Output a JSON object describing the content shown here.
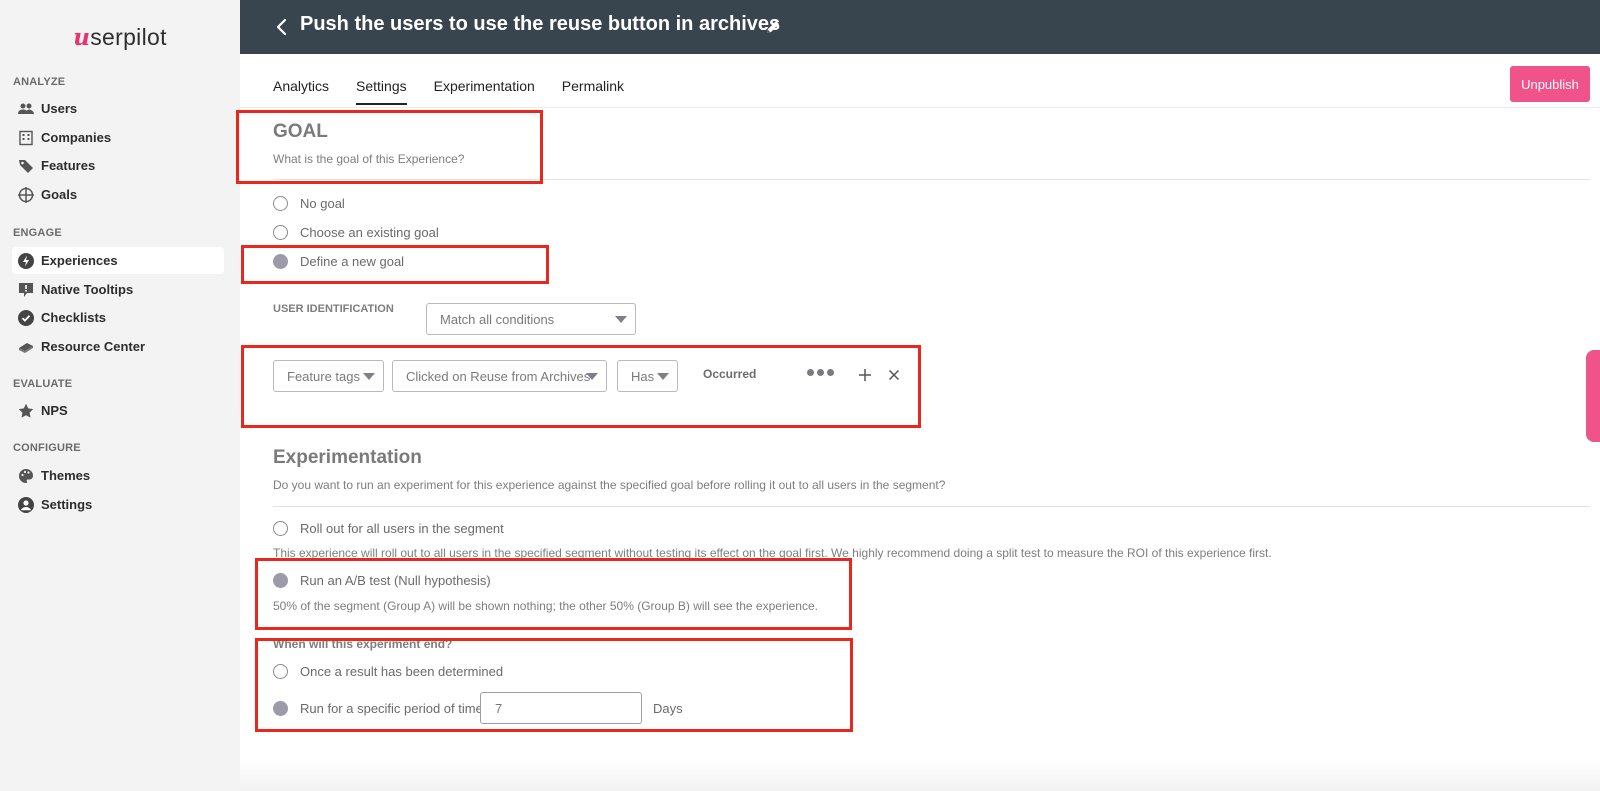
{
  "sidebar": {
    "logo_initial": "u",
    "logo_rest": "serpilot",
    "sections": [
      {
        "title": "ANALYZE",
        "items": [
          {
            "label": "Users",
            "icon": "users-icon"
          },
          {
            "label": "Companies",
            "icon": "building-icon"
          },
          {
            "label": "Features",
            "icon": "tag-icon"
          },
          {
            "label": "Goals",
            "icon": "crosshair-icon"
          }
        ]
      },
      {
        "title": "ENGAGE",
        "items": [
          {
            "label": "Experiences",
            "icon": "bolt-icon",
            "active": true
          },
          {
            "label": "Native Tooltips",
            "icon": "tooltip-icon"
          },
          {
            "label": "Checklists",
            "icon": "check-circle-icon"
          },
          {
            "label": "Resource Center",
            "icon": "book-icon"
          }
        ]
      },
      {
        "title": "EVALUATE",
        "items": [
          {
            "label": "NPS",
            "icon": "star-icon"
          }
        ]
      },
      {
        "title": "CONFIGURE",
        "items": [
          {
            "label": "Themes",
            "icon": "palette-icon"
          },
          {
            "label": "Settings",
            "icon": "user-circle-icon"
          }
        ]
      }
    ]
  },
  "header": {
    "title": "Push the users to use the reuse button in archives"
  },
  "tabs": [
    "Analytics",
    "Settings",
    "Experimentation",
    "Permalink"
  ],
  "active_tab": "Settings",
  "unpublish_label": "Unpublish",
  "goal": {
    "heading": "GOAL",
    "subtitle": "What is the goal of this Experience?",
    "options": [
      "No goal",
      "Choose an existing goal",
      "Define a new goal"
    ],
    "selected": "Define a new goal"
  },
  "user_identification": {
    "label": "USER IDENTIFICATION",
    "match_value": "Match all conditions"
  },
  "condition": {
    "source": "Feature tags",
    "event": "Clicked on Reuse from Archives",
    "operator": "Has",
    "status": "Occurred"
  },
  "experimentation": {
    "heading": "Experimentation",
    "subtitle": "Do you want to run an experiment for this experience against the specified goal before rolling it out to all users in the segment?",
    "rollout_label": "Roll out for all users in the segment",
    "rollout_desc": "This experience will roll out to all users in the specified segment without testing its effect on the goal first. We highly recommend doing a split test to measure the ROI of this experience first.",
    "ab_label": "Run an A/B test (Null hypothesis)",
    "ab_desc": "50% of the segment (Group A) will be shown nothing; the other 50% (Group B) will see the experience.",
    "end_question": "When will this experiment end?",
    "end_result_label": "Once a result has been determined",
    "end_period_label": "Run for a specific period of time",
    "period_value": "7",
    "period_unit": "Days"
  },
  "colors": {
    "accent": "#f0528a",
    "topbar": "#39454e",
    "highlight": "#e8281c",
    "radio_selected": "#9d9aaa"
  }
}
